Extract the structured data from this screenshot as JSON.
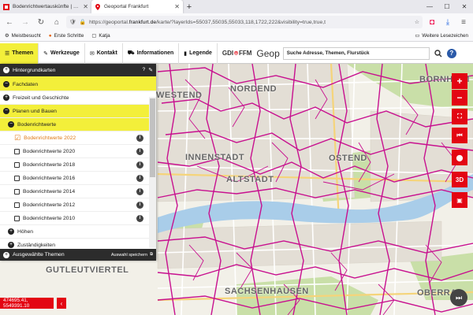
{
  "browser": {
    "tabs": [
      {
        "title": "Bodenrichtwertauskünfte | Stad",
        "active": false
      },
      {
        "title": "Geoportal Frankfurt",
        "active": true
      }
    ],
    "url_prefix": "https://geoportal.",
    "url_domain": "frankfurt.de",
    "url_rest": "/karte/?layerIds=55037,55035,55033,118,1722,222&visibility=true,true,t",
    "bookmarks": [
      "Meistbesucht",
      "Erste Schritte",
      "Katja"
    ],
    "other_bookmarks": "Weitere Lesezeichen"
  },
  "toolbar": {
    "items": [
      {
        "label": "Themen",
        "icon": "menu-icon",
        "active": true
      },
      {
        "label": "Werkzeuge",
        "icon": "wrench-icon"
      },
      {
        "label": "Kontakt",
        "icon": "mail-icon"
      },
      {
        "label": "Informationen",
        "icon": "car-icon"
      },
      {
        "label": "Legende",
        "icon": "book-icon"
      }
    ],
    "logo_left": "GDI",
    "logo_right": "FFM",
    "brand": "Geop",
    "search_placeholder": "Suche Adresse, Themen, Flurstück"
  },
  "panel": {
    "header": "Hintergrundkarten",
    "fachdaten": "Fachdaten",
    "freizeit": "Freizeit und Geschichte",
    "planen": "Planen und Bauen",
    "bodenrichtwerte": "Bodenrichtwerte",
    "layers": [
      {
        "label": "Bodenrichtwerte 2022",
        "checked": true
      },
      {
        "label": "Bodenrichtwerte 2020",
        "checked": false
      },
      {
        "label": "Bodenrichtwerte 2018",
        "checked": false
      },
      {
        "label": "Bodenrichtwerte 2016",
        "checked": false
      },
      {
        "label": "Bodenrichtwerte 2014",
        "checked": false
      },
      {
        "label": "Bodenrichtwerte 2012",
        "checked": false
      },
      {
        "label": "Bodenrichtwerte 2010",
        "checked": false
      }
    ],
    "hoehen": "Höhen",
    "zustaendigkeiten": "Zuständigkeiten",
    "footer": "Ausgewählte Themen",
    "footer_save": "Auswahl speichern"
  },
  "map": {
    "labels": {
      "nordend": "NORDEND",
      "westend": "WESTEND",
      "innenstadt": "INNENSTADT",
      "altstadt": "ALTSTADT",
      "ostend": "OSTEND",
      "gutleutviertel": "GUTLEUTVIERTEL",
      "sachsenhausen": "SACHSENHAUSEN",
      "oberrad": "OBERRA",
      "bornheim": "BORNHEIM"
    },
    "coordinates": "474695.41, 5549391.10",
    "controls": {
      "3d": "3D"
    }
  },
  "colors": {
    "accent_yellow": "#f3ef3a",
    "map_red": "#e30613",
    "boundary": "#c8108f"
  }
}
